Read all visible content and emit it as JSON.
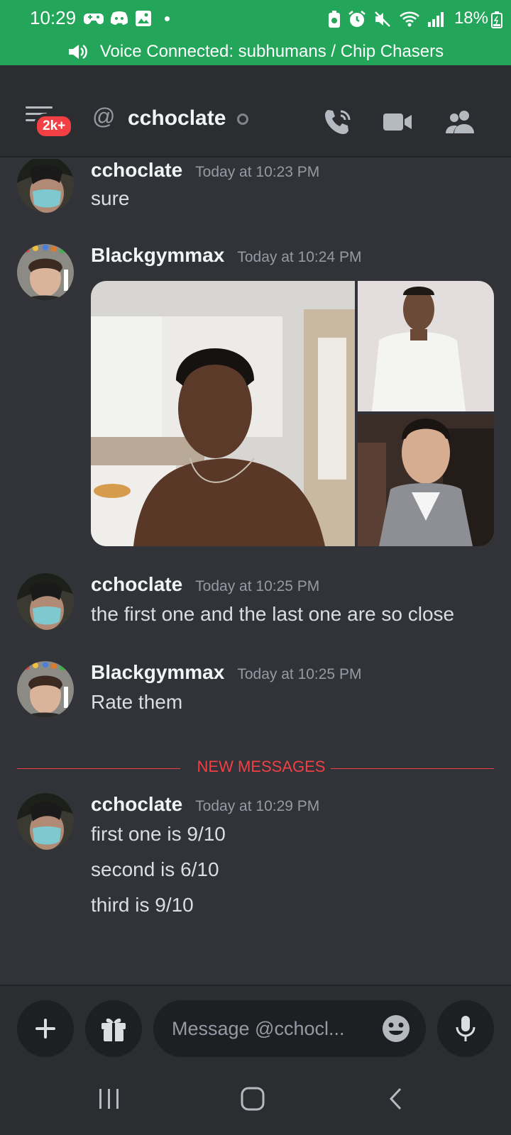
{
  "status_bar": {
    "time": "10:29",
    "battery_percent": "18%",
    "notification_icons": [
      "gamepad-icon",
      "discord-icon",
      "gallery-icon"
    ],
    "system_icons": [
      "battery-saver-icon",
      "alarm-icon",
      "mute-icon",
      "wifi-icon",
      "signal-icon"
    ]
  },
  "voice_banner": {
    "text": "Voice Connected: subhumans / Chip Chasers",
    "icon": "speaker-icon"
  },
  "header": {
    "badge": "2k+",
    "at_symbol": "@",
    "title": "cchoclate",
    "status": "offline",
    "actions": [
      "call-icon",
      "video-icon",
      "members-icon"
    ]
  },
  "messages": [
    {
      "author": "cchoclate",
      "timestamp": "Today at 10:23 PM",
      "lines": [
        "sure"
      ]
    },
    {
      "author": "Blackgymmax",
      "timestamp": "Today at 10:24 PM",
      "attachments": [
        "photo-1",
        "photo-2",
        "photo-3"
      ]
    },
    {
      "author": "cchoclate",
      "timestamp": "Today at 10:25 PM",
      "lines": [
        "the first one and the last one are so close"
      ]
    },
    {
      "author": "Blackgymmax",
      "timestamp": "Today at 10:25 PM",
      "lines": [
        "Rate them"
      ]
    },
    {
      "author": "cchoclate",
      "timestamp": "Today at 10:29 PM",
      "lines": [
        "first one is 9/10",
        "second is 6/10",
        "third is 9/10"
      ]
    }
  ],
  "new_messages_divider": "NEW MESSAGES",
  "composer": {
    "placeholder": "Message @cchocl..."
  },
  "colors": {
    "status_green": "#23a55a",
    "background": "#313338",
    "header_bg": "#2b2d31",
    "input_bg": "#1e1f22",
    "accent_red": "#f23f43"
  }
}
